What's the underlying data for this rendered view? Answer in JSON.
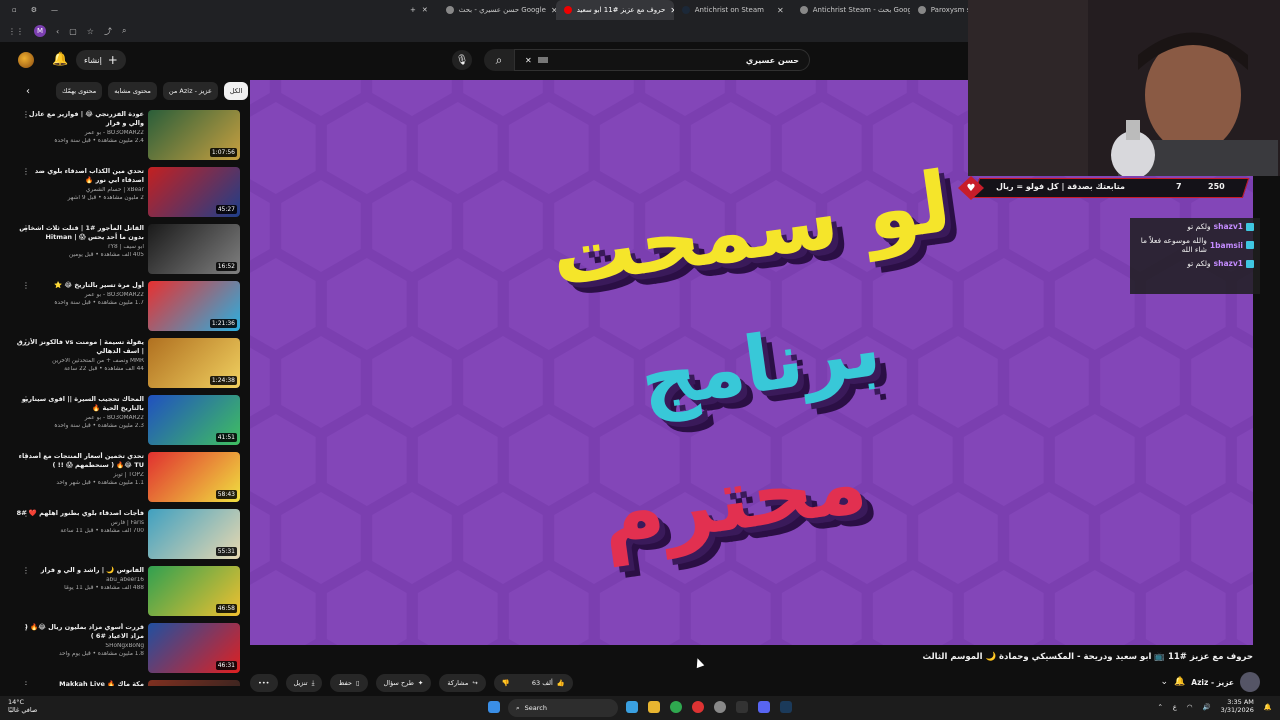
{
  "browser": {
    "tabs": [
      {
        "label": "حسن عسيري - بحث Google"
      },
      {
        "label": "حروف مع عزيز #11 ابو سعيد",
        "active": true
      },
      {
        "label": "Antichrist on Steam"
      },
      {
        "label": "Antichrist Steam - بحث Google"
      },
      {
        "label": "Paroxysm steam"
      }
    ],
    "profile_letter": "M"
  },
  "header": {
    "create_label": "إنشاء",
    "search_value": "حسن عسيري"
  },
  "chips": [
    "الكل",
    "من Aziz - عزيز",
    "محتوى مشابه",
    "محتوى يهمّك"
  ],
  "recommendations": [
    {
      "title": "عودة الفزرنجي 😂 | فوازير مع عادل والي و فراز",
      "channel": "BO3OMAR22 - بو عمر",
      "stats": "2.4 مليون مشاهدة • قبل سنة واحدة",
      "duration": "1:07:56",
      "colors": [
        "#2a5e3a",
        "#c8a040"
      ]
    },
    {
      "title": "تحدي مين الكذاب اصدقاء بلوي ضد اصدقاء ابي نور 🔥",
      "channel": "xBear | حسام الشمري",
      "stats": "2 مليون مشاهدة • قبل 9 أشهر",
      "duration": "45:27",
      "colors": [
        "#c42020",
        "#1e3f8a"
      ]
    },
    {
      "title": "القاتل المأجور #1 | قتلت ثلاث اشخاص بدون ما أحد يحس 😱 | Hitman",
      "channel": "أبو سيف | rY8",
      "stats": "405 ألف مشاهدة • قبل يومين",
      "duration": "16:52",
      "colors": [
        "#1a1a1a",
        "#808080"
      ]
    },
    {
      "title": "أول مرة تسير بالتاريخ 😂 ⭐",
      "channel": "BO3OMAR22 - بو عمر",
      "stats": "1.7 مليون مشاهدة • قبل سنة واحدة",
      "duration": "1:21:36",
      "colors": [
        "#e83030",
        "#2ab0e0"
      ]
    },
    {
      "title": "يقولة تسيمة | مومنت vs فالكونز الأزرق | اسف الدهالي",
      "channel": "MMR ونصف + من المتحدثين الأخرين",
      "stats": "44 ألف مشاهدة • قبل 22 ساعة",
      "duration": "1:24:38",
      "colors": [
        "#b07020",
        "#f0d060"
      ]
    },
    {
      "title": "المحاك تحجيب السيرة || اقوى سيناريو بالتاريخ الحية 🔥",
      "channel": "BO3OMAR22 - بو عمر",
      "stats": "2.3 مليون مشاهدة • قبل سنة واحدة",
      "duration": "41:51",
      "colors": [
        "#2050c0",
        "#40c060"
      ]
    },
    {
      "title": "تحدي تخمين أسعار المنتجات مع أصدقاء TU 😂🔥 ( سنحطمهم 😱 !! )",
      "channel": "TOPZ | توبز",
      "stats": "1.1 مليون مشاهدة • قبل شهر واحد",
      "duration": "58:43",
      "colors": [
        "#e03030",
        "#f0e040"
      ]
    },
    {
      "title": "فأجات اصدقاء بلوي بطنور اهلهم ❤️ #8",
      "channel": "Faris | فارس",
      "stats": "700 ألف مشاهدة • قبل 11 ساعة",
      "duration": "55:31",
      "colors": [
        "#40a0c0",
        "#e8d8b0"
      ]
    },
    {
      "title": "الفانوس 🌙 | راشد و الي و فراز",
      "channel": "abu_abeer16",
      "stats": "488 ألف مشاهدة • قبل 11 يومًا",
      "duration": "46:58",
      "colors": [
        "#30a050",
        "#f0c030"
      ]
    },
    {
      "title": "قررت أسوي مزاد بمليون ريال 😂🔥 ( مزاد الاعياد #6 )",
      "channel": "SHoNgxBoNg",
      "stats": "1.8 مليون مشاهدة • قبل يوم واحد",
      "duration": "46:31",
      "colors": [
        "#2050a0",
        "#e02020"
      ]
    },
    {
      "title": "مكة ماك 🔥 Makkah Live",
      "channel": "",
      "stats": "",
      "duration": "",
      "colors": [
        "#803020",
        "#202020"
      ]
    }
  ],
  "video": {
    "title": "حروف مع عزيز #11 📺 ابو سعيد ودريحة - المكسيكي وحمادة 🌙 الموسم الثالث",
    "art_line1": "لو سمحت",
    "art_line2": "برنامج",
    "art_line3": "محترم",
    "channel_name": "Aziz - عزيز",
    "likes": "63 ألف",
    "share_label": "مشاركة",
    "ask_label": "طرح سؤال",
    "save_label": "حفظ",
    "download_label": "تنزيل"
  },
  "overlay": {
    "follow_text": "متابعتك بصدقة | كل فولو = ريال",
    "count_a": "7",
    "count_b": "250",
    "chat": [
      {
        "user": "shazv1",
        "msg": "ولكم تو"
      },
      {
        "user": "1bamsii",
        "msg": "والله موسوعه فعلاً ما شاء الله"
      },
      {
        "user": "shazv1",
        "msg": "ولكم تو"
      }
    ]
  },
  "taskbar": {
    "temp": "14°C",
    "weather": "صافي غالبًا",
    "search": "Search",
    "time": "3:35 AM",
    "date": "3/31/2026",
    "lang": "ع"
  },
  "colors": {
    "player_bg": "#7b3fb0",
    "yellow": "#f5e52a",
    "cyan": "#38c8d8",
    "red": "#e23050",
    "banner_red": "#c81d2a"
  }
}
